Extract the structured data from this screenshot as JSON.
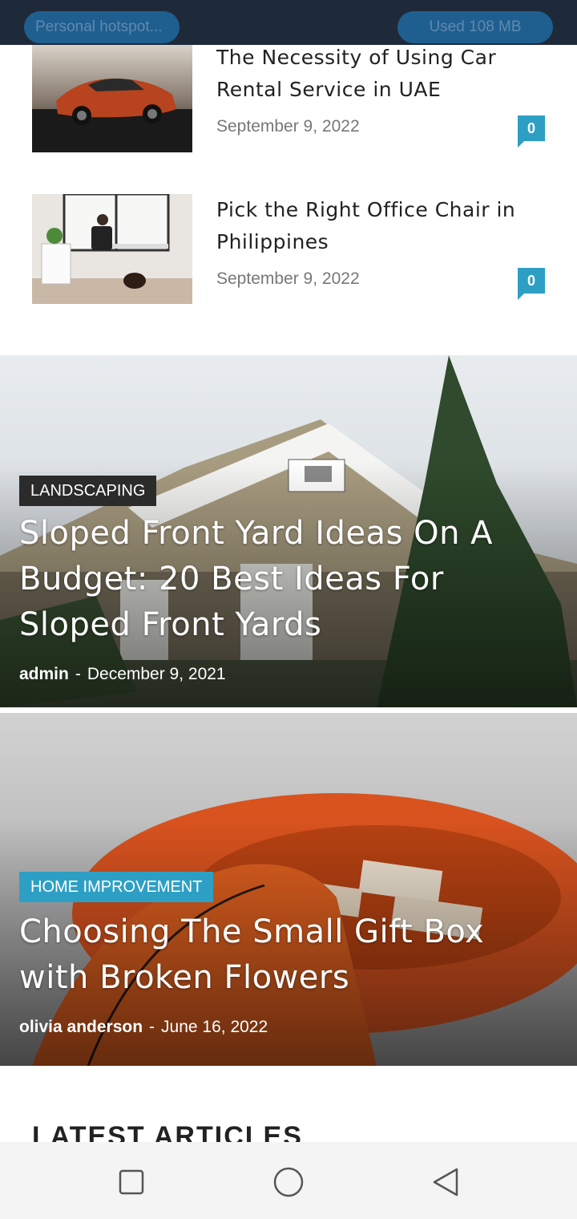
{
  "status_bar": {
    "hotspot_label": "Personal hotspot...",
    "data_used": "Used  108 MB"
  },
  "posts": [
    {
      "title": "The Necessity of Using Car Rental Service in UAE",
      "date": "September 9, 2022",
      "comments": "0",
      "thumb_icon": "car-image"
    },
    {
      "title": "Pick the Right Office Chair in Philippines",
      "date": "September 9, 2022",
      "comments": "0",
      "thumb_icon": "office-image"
    }
  ],
  "featured": [
    {
      "category": "LANDSCAPING",
      "category_color": "#2b2b2b",
      "title": "Sloped Front Yard Ideas On A Budget: 20 Best Ideas For Sloped Front Yards",
      "author": "admin",
      "separator": "-",
      "date": "December 9, 2021"
    },
    {
      "category": "HOME IMPROVEMENT",
      "category_color": "#2e9fc4",
      "title": "Choosing The Small Gift Box with Broken Flowers",
      "author": "olivia anderson",
      "separator": "-",
      "date": "June 16, 2022"
    }
  ],
  "section_heading": "LATEST ARTICLES",
  "nav": {
    "recents": "square-icon",
    "home": "circle-icon",
    "back": "triangle-back-icon"
  }
}
